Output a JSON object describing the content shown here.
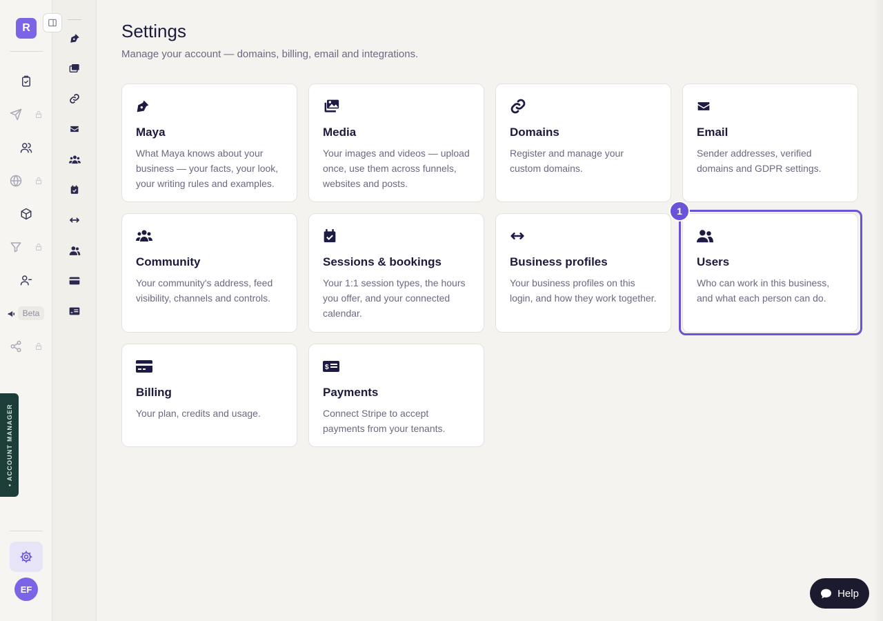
{
  "rail": {
    "brand_letter": "R",
    "beta_label": "Beta",
    "account_manager_label": "• ACCOUNT MANAGER",
    "avatar_initials": "EF",
    "items": [
      {
        "icon": "clipboard-check-icon",
        "locked": false
      },
      {
        "icon": "send-icon",
        "locked": true
      },
      {
        "icon": "users-icon",
        "locked": false
      },
      {
        "icon": "globe-icon",
        "locked": true
      },
      {
        "icon": "box-icon",
        "locked": false
      },
      {
        "icon": "filter-icon",
        "locked": true
      },
      {
        "icon": "people-icon",
        "locked": false
      },
      {
        "icon": "megaphone-icon",
        "locked": false
      },
      {
        "icon": "share-icon",
        "locked": true
      }
    ]
  },
  "subnav": {
    "items": [
      "pen-icon",
      "images-icon",
      "link-icon",
      "envelope-icon",
      "community-icon",
      "calendar-check-icon",
      "arrows-icon",
      "user-group-icon",
      "credit-card-icon",
      "money-check-icon"
    ]
  },
  "page": {
    "title": "Settings",
    "subtitle": "Manage your account — domains, billing, email and integrations."
  },
  "cards": [
    {
      "icon": "pen-nib-icon",
      "title": "Maya",
      "desc": "What Maya knows about your business — your facts, your look, your writing rules and examples."
    },
    {
      "icon": "images-icon",
      "title": "Media",
      "desc": "Your images and videos — upload once, use them across funnels, websites and posts."
    },
    {
      "icon": "link-icon",
      "title": "Domains",
      "desc": "Register and manage your custom domains."
    },
    {
      "icon": "envelope-icon",
      "title": "Email",
      "desc": "Sender addresses, verified domains and GDPR settings."
    },
    {
      "icon": "community-icon",
      "title": "Community",
      "desc": "Your community's address, feed visibility, channels and controls."
    },
    {
      "icon": "calendar-check-icon",
      "title": "Sessions & bookings",
      "desc": "Your 1:1 session types, the hours you offer, and your connected calendar."
    },
    {
      "icon": "arrows-left-right-icon",
      "title": "Business profiles",
      "desc": "Your business profiles on this login, and how they work together."
    },
    {
      "icon": "user-group-icon",
      "title": "Users",
      "desc": "Who can work in this business, and what each person can do."
    },
    {
      "icon": "credit-card-icon",
      "title": "Billing",
      "desc": "Your plan, credits and usage."
    },
    {
      "icon": "money-check-icon",
      "title": "Payments",
      "desc": "Connect Stripe to accept payments from your tenants."
    }
  ],
  "highlight": {
    "badge": "1",
    "target": "Users"
  },
  "help": {
    "label": "Help"
  },
  "colors": {
    "accent": "#6a52d9",
    "brand": "#7d64e6",
    "account_tab": "#1d3d38",
    "help_button": "#1c1a2e"
  }
}
